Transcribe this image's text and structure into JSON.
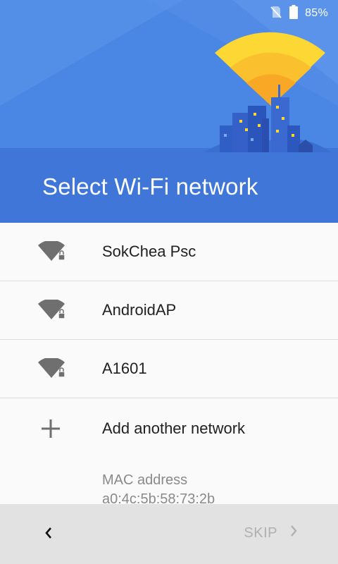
{
  "status_bar": {
    "battery_percent": "85%",
    "icons": [
      "no-sim-icon",
      "battery-icon"
    ]
  },
  "header": {
    "title": "Select Wi-Fi network",
    "illustration": "city-wifi-illustration"
  },
  "networks": [
    {
      "ssid": "SokChea Psc",
      "secured": true,
      "icon": "wifi-lock-icon"
    },
    {
      "ssid": "AndroidAP",
      "secured": true,
      "icon": "wifi-lock-icon"
    },
    {
      "ssid": "A1601",
      "secured": true,
      "icon": "wifi-lock-icon"
    }
  ],
  "add_network": {
    "label": "Add another network",
    "icon": "plus-icon"
  },
  "mac": {
    "label": "MAC address",
    "value": "a0:4c:5b:58:73:2b"
  },
  "nav": {
    "skip_label": "SKIP",
    "back_icon": "chevron-left-icon",
    "skip_icon": "chevron-right-icon"
  },
  "colors": {
    "header_blue": "#4a80df",
    "header_light": "#5b8fe6",
    "ray_yellow": "#fdd835",
    "nav_bg": "#e2e2e2",
    "skip_disabled": "#b0b0b0"
  }
}
